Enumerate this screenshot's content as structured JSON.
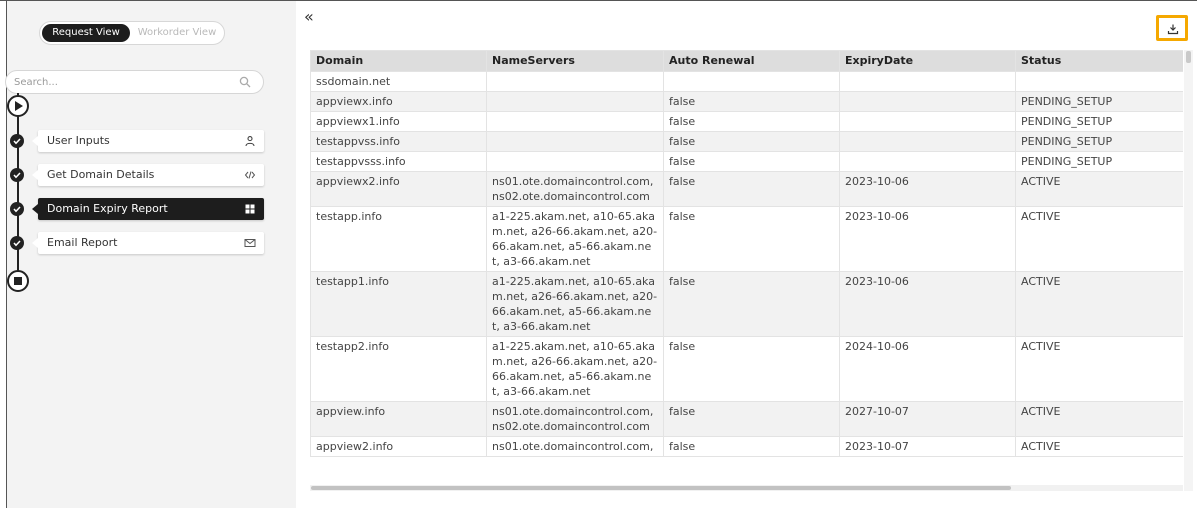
{
  "view_toggle": {
    "request_label": "Request View",
    "workorder_label": "Workorder View",
    "selected": "Request View"
  },
  "search": {
    "placeholder": "Search..."
  },
  "workflow": {
    "steps": [
      {
        "label": "User Inputs",
        "icon": "user-icon",
        "active": false,
        "completed": true
      },
      {
        "label": "Get Domain Details",
        "icon": "code-icon",
        "active": false,
        "completed": true
      },
      {
        "label": "Domain Expiry Report",
        "icon": "dashboard-icon",
        "active": true,
        "completed": true
      },
      {
        "label": "Email Report",
        "icon": "email-icon",
        "active": false,
        "completed": true
      }
    ]
  },
  "toolbar": {
    "collapse_glyph": "«",
    "export_icon": "download-icon",
    "highlight_color": "#f5a800"
  },
  "table": {
    "columns": [
      "Domain",
      "NameServers",
      "Auto Renewal",
      "ExpiryDate",
      "Status"
    ],
    "rows": [
      [
        "ssdomain.net",
        "",
        "",
        "",
        ""
      ],
      [
        "appviewx.info",
        "",
        "false",
        "",
        "PENDING_SETUP"
      ],
      [
        "appviewx1.info",
        "",
        "false",
        "",
        "PENDING_SETUP"
      ],
      [
        "testappvss.info",
        "",
        "false",
        "",
        "PENDING_SETUP"
      ],
      [
        "testappvsss.info",
        "",
        "false",
        "",
        "PENDING_SETUP"
      ],
      [
        "appviewx2.info",
        "ns01.ote.domaincontrol.com, ns02.ote.domaincontrol.com",
        "false",
        "2023-10-06",
        "ACTIVE"
      ],
      [
        "testapp.info",
        "a1-225.akam.net, a10-65.akam.net, a26-66.akam.net, a20-66.akam.net, a5-66.akam.net, a3-66.akam.net",
        "false",
        "2023-10-06",
        "ACTIVE"
      ],
      [
        "testapp1.info",
        "a1-225.akam.net, a10-65.akam.net, a26-66.akam.net, a20-66.akam.net, a5-66.akam.net, a3-66.akam.net",
        "false",
        "2023-10-06",
        "ACTIVE"
      ],
      [
        "testapp2.info",
        "a1-225.akam.net, a10-65.akam.net, a26-66.akam.net, a20-66.akam.net, a5-66.akam.net, a3-66.akam.net",
        "false",
        "2024-10-06",
        "ACTIVE"
      ],
      [
        "appview.info",
        "ns01.ote.domaincontrol.com, ns02.ote.domaincontrol.com",
        "false",
        "2027-10-07",
        "ACTIVE"
      ],
      [
        "appview2.info",
        "ns01.ote.domaincontrol.com,",
        "false",
        "2023-10-07",
        "ACTIVE"
      ]
    ]
  }
}
